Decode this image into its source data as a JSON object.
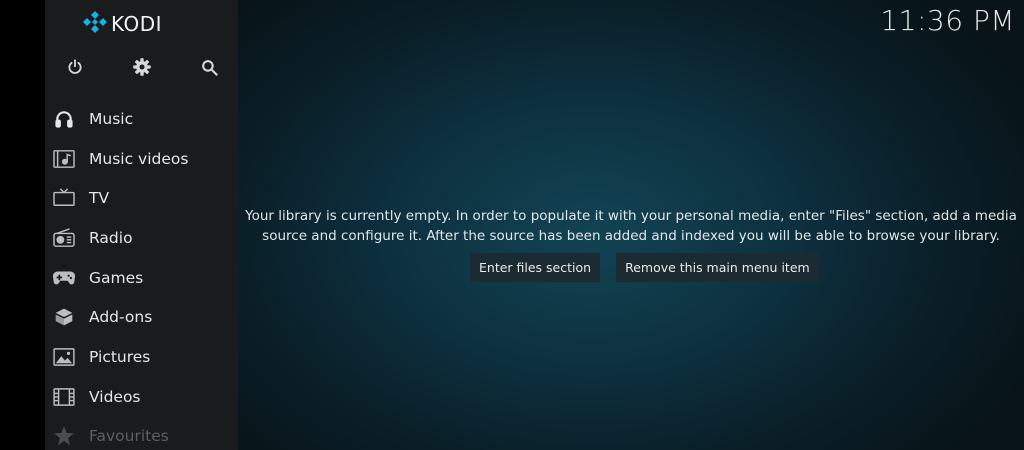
{
  "app": {
    "logo_text": "KODI",
    "clock": "11:36 PM",
    "accent": "#17b2e8"
  },
  "top_icons": [
    {
      "name": "power-icon"
    },
    {
      "name": "gear-icon"
    },
    {
      "name": "search-icon"
    }
  ],
  "menu": {
    "items": [
      {
        "label": "Music",
        "icon": "headphones-icon"
      },
      {
        "label": "Music videos",
        "icon": "music-video-icon"
      },
      {
        "label": "TV",
        "icon": "tv-icon"
      },
      {
        "label": "Radio",
        "icon": "radio-icon"
      },
      {
        "label": "Games",
        "icon": "gamepad-icon"
      },
      {
        "label": "Add-ons",
        "icon": "addons-box-icon"
      },
      {
        "label": "Pictures",
        "icon": "picture-icon"
      },
      {
        "label": "Videos",
        "icon": "film-icon"
      },
      {
        "label": "Favourites",
        "icon": "star-icon"
      }
    ]
  },
  "main": {
    "empty_line1": "Your library is currently empty. In order to populate it with your personal media, enter \"Files\" section, add a media",
    "empty_line2": "source and configure it. After the source has been added and indexed you will be able to browse your library.",
    "enter_files_label": "Enter files section",
    "remove_item_label": "Remove this main menu item"
  }
}
